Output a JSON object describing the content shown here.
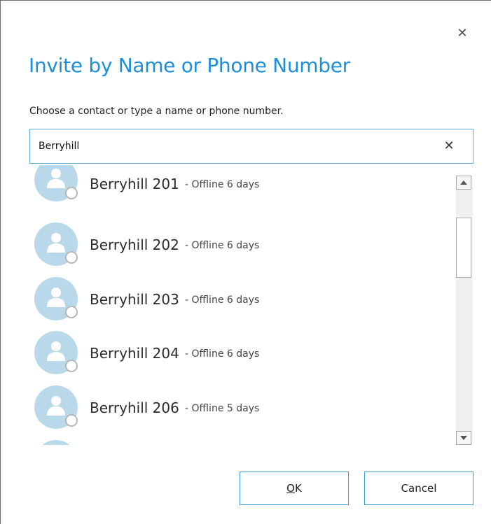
{
  "dialog": {
    "title": "Invite by Name or Phone Number",
    "instruction": "Choose a contact or type a name or phone number.",
    "close_icon": "close-icon"
  },
  "search": {
    "value": "Berryhill",
    "placeholder": "",
    "clear_icon": "close-icon"
  },
  "results": [
    {
      "name": "Berryhill 201",
      "status": "- Offline 6 days"
    },
    {
      "name": "Berryhill 202",
      "status": "- Offline 6 days"
    },
    {
      "name": "Berryhill 203",
      "status": "- Offline 6 days"
    },
    {
      "name": "Berryhill 204",
      "status": "- Offline 6 days"
    },
    {
      "name": "Berryhill 206",
      "status": "- Offline 5 days"
    }
  ],
  "buttons": {
    "ok_access_key": "O",
    "ok_rest": "K",
    "cancel_label": "Cancel"
  },
  "colors": {
    "accent": "#1d8fd6",
    "avatar_bg": "#b9d9ea",
    "button_border": "#3b9ad9"
  }
}
